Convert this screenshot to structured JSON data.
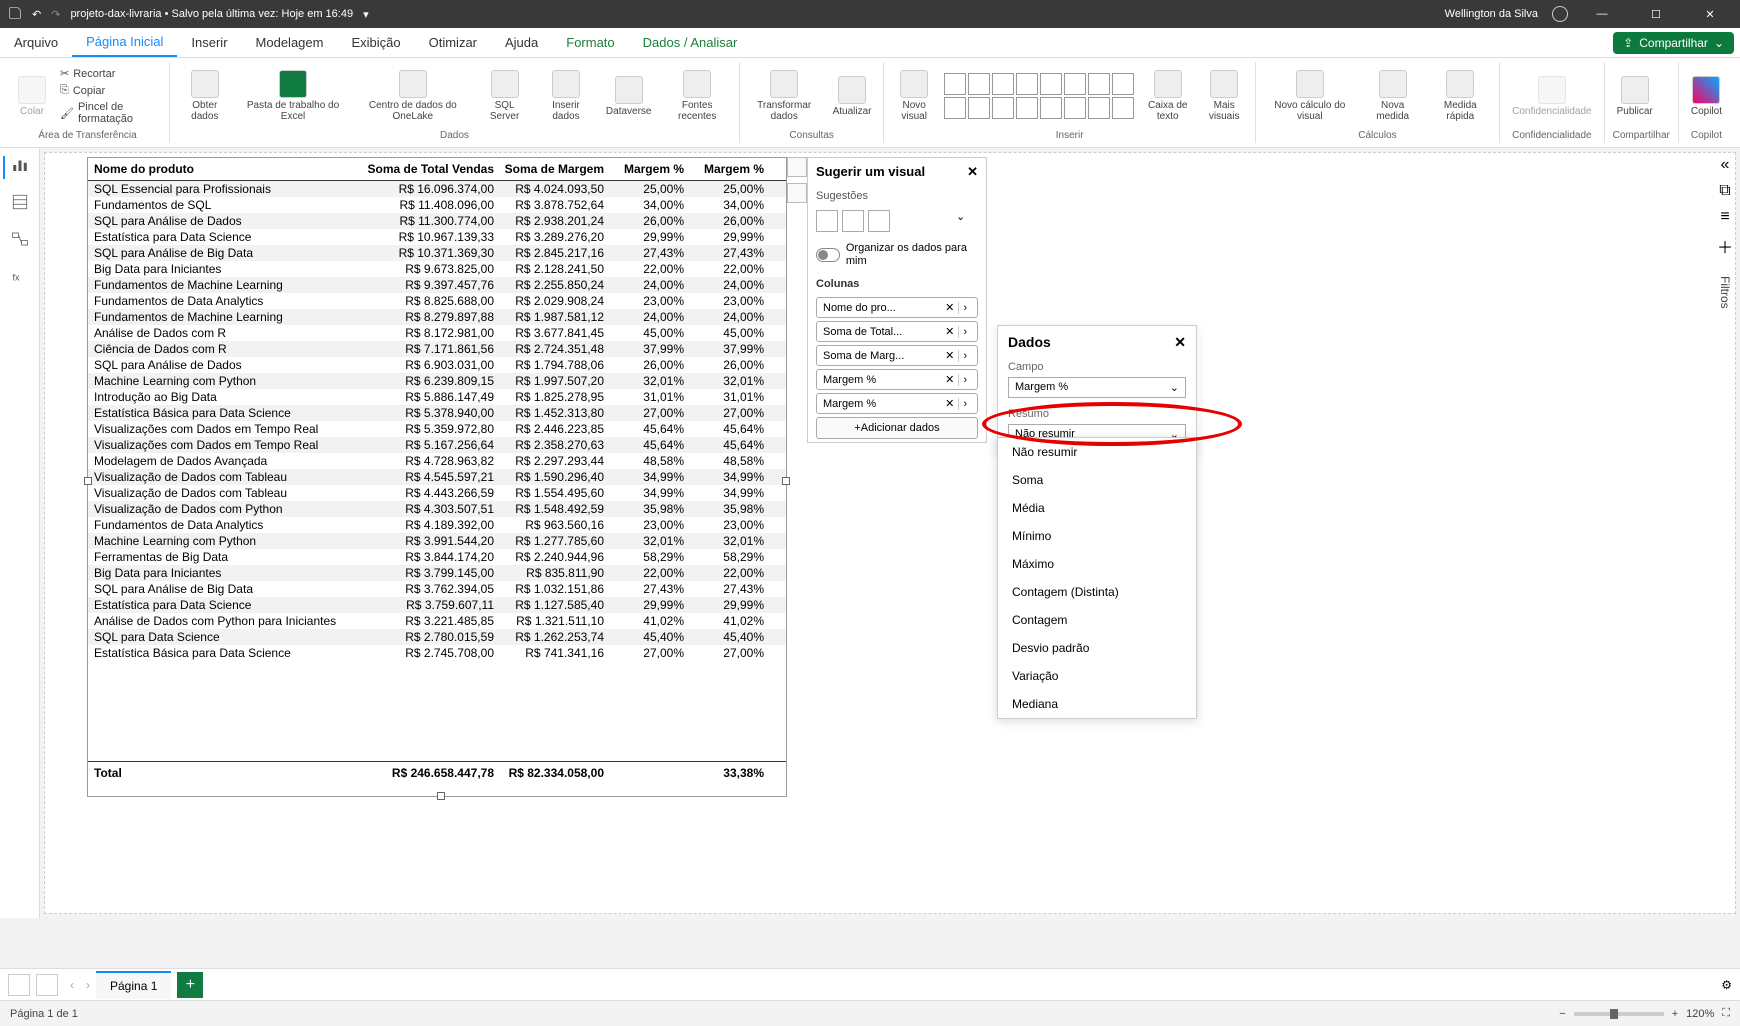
{
  "titlebar": {
    "filename": "projeto-dax-livraria • Salvo pela última vez: Hoje em 16:49",
    "user": "Wellington da Silva"
  },
  "menu": {
    "arquivo": "Arquivo",
    "pagina_inicial": "Página Inicial",
    "inserir": "Inserir",
    "modelagem": "Modelagem",
    "exibicao": "Exibição",
    "otimizar": "Otimizar",
    "ajuda": "Ajuda",
    "formato": "Formato",
    "dados_analisar": "Dados / Analisar",
    "compartilhar": "Compartilhar"
  },
  "ribbon": {
    "colar": "Colar",
    "recortar": "Recortar",
    "copiar": "Copiar",
    "pincel": "Pincel de formatação",
    "area_trans": "Área de Transferência",
    "obter_dados": "Obter\ndados",
    "pasta_excel": "Pasta de trabalho do\nExcel",
    "centro_onel": "Centro de dados do\nOneLake",
    "sql": "SQL\nServer",
    "inserir_dados": "Inserir\ndados",
    "dataverse": "Dataverse",
    "fontes": "Fontes\nrecentes",
    "dados_label": "Dados",
    "transformar": "Transformar\ndados",
    "atualizar": "Atualizar",
    "consultas": "Consultas",
    "novo_visual": "Novo\nvisual",
    "inserir_label": "Inserir",
    "caixa_texto": "Caixa de\ntexto",
    "mais_visuais": "Mais\nvisuais",
    "novo_calc": "Novo cálculo do\nvisual",
    "nova_medida": "Nova\nmedida",
    "medida_rapida": "Medida\nrápida",
    "calculos": "Cálculos",
    "confidencialidade": "Confidencialidade",
    "publicar": "Publicar",
    "compartilhar": "Compartilhar",
    "copilot": "Copilot"
  },
  "table": {
    "headers": [
      "Nome do produto",
      "Soma de Total Vendas",
      "Soma de Margem",
      "Margem %",
      "Margem %"
    ],
    "rows": [
      [
        "SQL Essencial para Profissionais",
        "R$ 16.096.374,00",
        "R$ 4.024.093,50",
        "25,00%",
        "25,00%"
      ],
      [
        "Fundamentos de SQL",
        "R$ 11.408.096,00",
        "R$ 3.878.752,64",
        "34,00%",
        "34,00%"
      ],
      [
        "SQL para Análise de Dados",
        "R$ 11.300.774,00",
        "R$ 2.938.201,24",
        "26,00%",
        "26,00%"
      ],
      [
        "Estatística para Data Science",
        "R$ 10.967.139,33",
        "R$ 3.289.276,20",
        "29,99%",
        "29,99%"
      ],
      [
        "SQL para Análise de Big Data",
        "R$ 10.371.369,30",
        "R$ 2.845.217,16",
        "27,43%",
        "27,43%"
      ],
      [
        "Big Data para Iniciantes",
        "R$ 9.673.825,00",
        "R$ 2.128.241,50",
        "22,00%",
        "22,00%"
      ],
      [
        "Fundamentos de Machine Learning",
        "R$ 9.397.457,76",
        "R$ 2.255.850,24",
        "24,00%",
        "24,00%"
      ],
      [
        "Fundamentos de Data Analytics",
        "R$ 8.825.688,00",
        "R$ 2.029.908,24",
        "23,00%",
        "23,00%"
      ],
      [
        "Fundamentos de Machine Learning",
        "R$ 8.279.897,88",
        "R$ 1.987.581,12",
        "24,00%",
        "24,00%"
      ],
      [
        "Análise de Dados com R",
        "R$ 8.172.981,00",
        "R$ 3.677.841,45",
        "45,00%",
        "45,00%"
      ],
      [
        "Ciência de Dados com R",
        "R$ 7.171.861,56",
        "R$ 2.724.351,48",
        "37,99%",
        "37,99%"
      ],
      [
        "SQL para Análise de Dados",
        "R$ 6.903.031,00",
        "R$ 1.794.788,06",
        "26,00%",
        "26,00%"
      ],
      [
        "Machine Learning com Python",
        "R$ 6.239.809,15",
        "R$ 1.997.507,20",
        "32,01%",
        "32,01%"
      ],
      [
        "Introdução ao Big Data",
        "R$ 5.886.147,49",
        "R$ 1.825.278,95",
        "31,01%",
        "31,01%"
      ],
      [
        "Estatística Básica para Data Science",
        "R$ 5.378.940,00",
        "R$ 1.452.313,80",
        "27,00%",
        "27,00%"
      ],
      [
        "Visualizações com Dados em Tempo Real",
        "R$ 5.359.972,80",
        "R$ 2.446.223,85",
        "45,64%",
        "45,64%"
      ],
      [
        "Visualizações com Dados em Tempo Real",
        "R$ 5.167.256,64",
        "R$ 2.358.270,63",
        "45,64%",
        "45,64%"
      ],
      [
        "Modelagem de Dados Avançada",
        "R$ 4.728.963,82",
        "R$ 2.297.293,44",
        "48,58%",
        "48,58%"
      ],
      [
        "Visualização de Dados com Tableau",
        "R$ 4.545.597,21",
        "R$ 1.590.296,40",
        "34,99%",
        "34,99%"
      ],
      [
        "Visualização de Dados com Tableau",
        "R$ 4.443.266,59",
        "R$ 1.554.495,60",
        "34,99%",
        "34,99%"
      ],
      [
        "Visualização de Dados com Python",
        "R$ 4.303.507,51",
        "R$ 1.548.492,59",
        "35,98%",
        "35,98%"
      ],
      [
        "Fundamentos de Data Analytics",
        "R$ 4.189.392,00",
        "R$ 963.560,16",
        "23,00%",
        "23,00%"
      ],
      [
        "Machine Learning com Python",
        "R$ 3.991.544,20",
        "R$ 1.277.785,60",
        "32,01%",
        "32,01%"
      ],
      [
        "Ferramentas de Big Data",
        "R$ 3.844.174,20",
        "R$ 2.240.944,96",
        "58,29%",
        "58,29%"
      ],
      [
        "Big Data para Iniciantes",
        "R$ 3.799.145,00",
        "R$ 835.811,90",
        "22,00%",
        "22,00%"
      ],
      [
        "SQL para Análise de Big Data",
        "R$ 3.762.394,05",
        "R$ 1.032.151,86",
        "27,43%",
        "27,43%"
      ],
      [
        "Estatística para Data Science",
        "R$ 3.759.607,11",
        "R$ 1.127.585,40",
        "29,99%",
        "29,99%"
      ],
      [
        "Análise de Dados com Python para Iniciantes",
        "R$ 3.221.485,85",
        "R$ 1.321.511,10",
        "41,02%",
        "41,02%"
      ],
      [
        "SQL para Data Science",
        "R$ 2.780.015,59",
        "R$ 1.262.253,74",
        "45,40%",
        "45,40%"
      ],
      [
        "Estatística Básica para Data Science",
        "R$ 2.745.708,00",
        "R$ 741.341,16",
        "27,00%",
        "27,00%"
      ]
    ],
    "total": [
      "Total",
      "R$ 246.658.447,78",
      "R$ 82.334.058,00",
      "",
      "33,38%"
    ]
  },
  "sugerir": {
    "title": "Sugerir um visual",
    "sugestoes": "Sugestões",
    "organizar": "Organizar os dados para mim",
    "colunas": "Colunas",
    "pills": [
      "Nome do pro...",
      "Soma de Total...",
      "Soma de Marg...",
      "Margem %",
      "Margem %"
    ],
    "add": "+Adicionar dados"
  },
  "dados": {
    "title": "Dados",
    "campo": "Campo",
    "campo_val": "Margem %",
    "resumo": "Resumo",
    "resumo_val": "Não resumir",
    "options": [
      "Não resumir",
      "Soma",
      "Média",
      "Mínimo",
      "Máximo",
      "Contagem (Distinta)",
      "Contagem",
      "Desvio padrão",
      "Variação",
      "Mediana"
    ]
  },
  "filter_label": "Filtros",
  "page": {
    "tab": "Página 1",
    "status": "Página 1 de 1",
    "zoom": "120%"
  }
}
